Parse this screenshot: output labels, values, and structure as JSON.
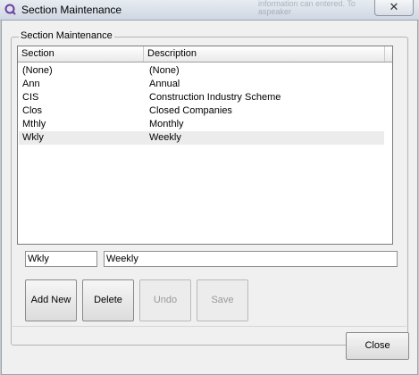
{
  "window": {
    "title": "Section Maintenance",
    "icon": "app-logo-icon",
    "close_glyph": "✕",
    "background_text": "information can entered. To aspeaker"
  },
  "group": {
    "label": "Section Maintenance"
  },
  "list": {
    "columns": [
      "Section",
      "Description"
    ],
    "rows": [
      {
        "section": "(None)",
        "description": "(None)"
      },
      {
        "section": "Ann",
        "description": "Annual"
      },
      {
        "section": "CIS",
        "description": "Construction Industry Scheme"
      },
      {
        "section": "Clos",
        "description": "Closed Companies"
      },
      {
        "section": "Mthly",
        "description": "Monthly"
      },
      {
        "section": "Wkly",
        "description": "Weekly"
      }
    ],
    "selected_index": 5
  },
  "editor": {
    "section_value": "Wkly",
    "description_value": "Weekly"
  },
  "buttons": {
    "add_new": "Add New",
    "delete": "Delete",
    "undo": "Undo",
    "save": "Save",
    "close": "Close"
  },
  "colors": {
    "accent": "#6b3fa0",
    "selected_row": "#ececec"
  }
}
